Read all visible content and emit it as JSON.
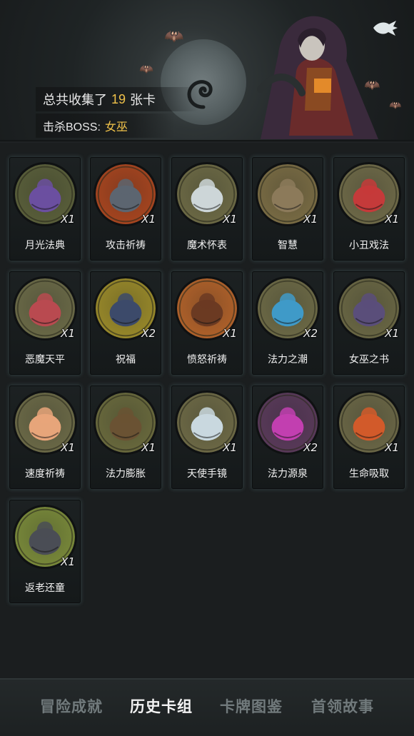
{
  "header": {
    "collected_prefix": "总共收集了",
    "collected_count": "19",
    "collected_suffix": "张卡",
    "boss_label": "击杀BOSS:",
    "boss_name": "女巫"
  },
  "back_icon": "back-arrow-icon",
  "colors": {
    "accent_gold": "#f0c24a",
    "card_glow": "#8cc8cd",
    "tab_active": "#f3f3f3",
    "tab_inactive": "#717a7c"
  },
  "cards": [
    {
      "name": "月光法典",
      "count": "X1",
      "icon": "moonlight-codex-icon",
      "bg": "#5a5f3a",
      "fg": "#6b4fa0"
    },
    {
      "name": "攻击祈祷",
      "count": "X1",
      "icon": "attack-prayer-icon",
      "bg": "#a8451f",
      "fg": "#5c6570"
    },
    {
      "name": "魔术怀表",
      "count": "X1",
      "icon": "magic-pocket-watch-icon",
      "bg": "#6d6a45",
      "fg": "#cdd6d8"
    },
    {
      "name": "智慧",
      "count": "X1",
      "icon": "wisdom-icon",
      "bg": "#7a6c44",
      "fg": "#8c7a5a"
    },
    {
      "name": "小丑戏法",
      "count": "X1",
      "icon": "clown-trick-icon",
      "bg": "#6f6a48",
      "fg": "#c53a3a"
    },
    {
      "name": "恶魔天平",
      "count": "X1",
      "icon": "demon-scale-icon",
      "bg": "#6b6a47",
      "fg": "#b94a50"
    },
    {
      "name": "祝福",
      "count": "X2",
      "icon": "blessing-icon",
      "bg": "#9a8a2a",
      "fg": "#3c4a6a"
    },
    {
      "name": "愤怒祈祷",
      "count": "X1",
      "icon": "rage-prayer-icon",
      "bg": "#b2622a",
      "fg": "#6b3a22"
    },
    {
      "name": "法力之潮",
      "count": "X2",
      "icon": "mana-tide-icon",
      "bg": "#6d6a46",
      "fg": "#3f9ac8"
    },
    {
      "name": "女巫之书",
      "count": "X1",
      "icon": "witch-book-icon",
      "bg": "#6a6744",
      "fg": "#5a4e7a"
    },
    {
      "name": "速度祈祷",
      "count": "X1",
      "icon": "speed-prayer-icon",
      "bg": "#6c6a47",
      "fg": "#e7a57a"
    },
    {
      "name": "法力膨胀",
      "count": "X1",
      "icon": "mana-surge-icon",
      "bg": "#6a6a3d",
      "fg": "#6a5233"
    },
    {
      "name": "天使手镜",
      "count": "X1",
      "icon": "angel-hand-mirror-icon",
      "bg": "#6e6a46",
      "fg": "#c9d8df"
    },
    {
      "name": "法力源泉",
      "count": "X2",
      "icon": "mana-fountain-icon",
      "bg": "#5a3a5a",
      "fg": "#c23fb0"
    },
    {
      "name": "生命吸取",
      "count": "X1",
      "icon": "life-drain-icon",
      "bg": "#6b6746",
      "fg": "#d25a2a"
    },
    {
      "name": "返老还童",
      "count": "X1",
      "icon": "rejuvenation-icon",
      "bg": "#7a8a3a",
      "fg": "#4a4d55"
    }
  ],
  "tabs": [
    {
      "label": "冒险成就",
      "active": false
    },
    {
      "label": "历史卡组",
      "active": true
    },
    {
      "label": "卡牌图鉴",
      "active": false
    },
    {
      "label": "首领故事",
      "active": false
    }
  ]
}
